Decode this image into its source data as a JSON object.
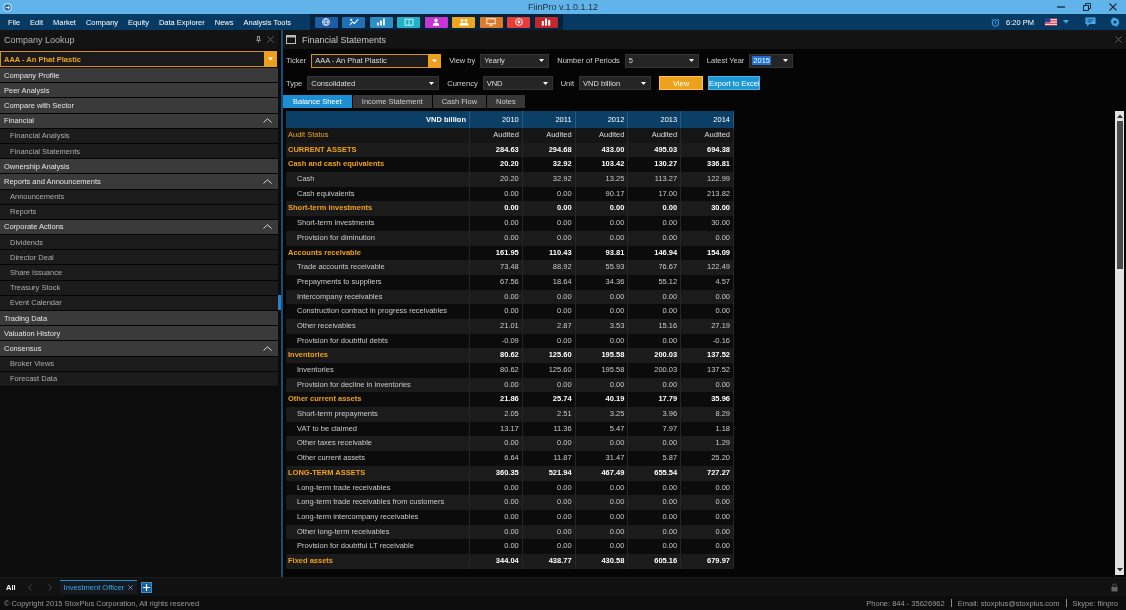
{
  "window": {
    "title": "FiinPro v.1.0.1.12"
  },
  "menu": [
    "File",
    "Edit",
    "Market",
    "Company",
    "Equity",
    "Data Explorer",
    "News",
    "Analysis Tools"
  ],
  "toolbar": [
    {
      "color": "#1f5ca6"
    },
    {
      "color": "#1f72b6"
    },
    {
      "color": "#2d8dc6"
    },
    {
      "color": "#20b2c8"
    },
    {
      "color": "#c634d4"
    },
    {
      "color": "#eea61f"
    },
    {
      "color": "#de7b2b"
    },
    {
      "color": "#e53c3c"
    },
    {
      "color": "#c1282d"
    }
  ],
  "clock": {
    "time": "6:20 PM"
  },
  "company_lookup": {
    "title": "Company Lookup",
    "ticker": "AAA - An Phat Plastic",
    "items": [
      {
        "label": "Company Profile"
      },
      {
        "label": "Peer Analysis"
      },
      {
        "label": "Compare with Sector"
      },
      {
        "label": "Financial",
        "expanded": true,
        "children": [
          {
            "label": "Financial Analysis"
          },
          {
            "label": "Financial Statements"
          }
        ]
      },
      {
        "label": "Ownership Analysis"
      },
      {
        "label": "Reports and Announcements",
        "expanded": true,
        "children": [
          {
            "label": "Announcements"
          },
          {
            "label": "Reports"
          }
        ]
      },
      {
        "label": "Corporate Actions",
        "expanded": true,
        "children": [
          {
            "label": "Dividends"
          },
          {
            "label": "Director Deal"
          },
          {
            "label": "Share Issuance"
          },
          {
            "label": "Treasury Stock"
          },
          {
            "label": "Event Calendar"
          }
        ]
      },
      {
        "label": "Trading Data"
      },
      {
        "label": "Valuation History"
      },
      {
        "label": "Consensus",
        "expanded": true,
        "children": [
          {
            "label": "Broker Views"
          },
          {
            "label": "Forecast Data"
          }
        ]
      }
    ]
  },
  "financial_statements": {
    "title": "Financial Statements",
    "filter_rows": [
      [
        {
          "label": "Ticker",
          "value": "AAA - An Phat Plastic",
          "focused": true,
          "text_selected": false
        },
        {
          "label": "View by",
          "value": "Yearly",
          "focused": false,
          "text_selected": false
        },
        {
          "label": "Number of Periods",
          "value": "5",
          "focused": false,
          "text_selected": false
        },
        {
          "label": "Latest Year",
          "value": "2015",
          "focused": false,
          "text_selected": true
        }
      ],
      [
        {
          "label": "Type",
          "value": "Consolidated",
          "focused": false,
          "text_selected": false
        },
        {
          "label": "Currency",
          "value": "VND",
          "focused": false,
          "text_selected": false
        },
        {
          "label": "Unit",
          "value": "VND billion",
          "focused": false,
          "text_selected": false
        }
      ]
    ],
    "buttons": [
      {
        "label": "View",
        "kind": "primary"
      },
      {
        "label": "Export to Excel",
        "kind": "export"
      }
    ],
    "tabs": [
      {
        "label": "Balance Sheet",
        "selected": true
      },
      {
        "label": "Income Statement",
        "selected": false
      },
      {
        "label": "Cash Flow",
        "selected": false
      },
      {
        "label": "Notes",
        "selected": false
      }
    ],
    "table": {
      "columns": [
        "VND billion",
        "2010",
        "2011",
        "2012",
        "2013",
        "2014"
      ],
      "rows": [
        {
          "kind": "audit",
          "label": "Audit Status",
          "values": [
            "Audited",
            "Audited",
            "Audited",
            "Audited",
            "Audited"
          ]
        },
        {
          "kind": "group",
          "label": "CURRENT ASSETS",
          "values": [
            "284.63",
            "294.68",
            "433.00",
            "495.03",
            "694.38"
          ]
        },
        {
          "kind": "group",
          "label": "Cash and cash equivalents",
          "values": [
            "20.20",
            "32.92",
            "103.42",
            "130.27",
            "336.81"
          ]
        },
        {
          "kind": "item",
          "label": "Cash",
          "values": [
            "20.20",
            "32.92",
            "13.25",
            "113.27",
            "122.99"
          ]
        },
        {
          "kind": "item",
          "label": "Cash equivalents",
          "values": [
            "0.00",
            "0.00",
            "90.17",
            "17.00",
            "213.82"
          ]
        },
        {
          "kind": "group",
          "label": "Short-term investments",
          "values": [
            "0.00",
            "0.00",
            "0.00",
            "0.00",
            "30.00"
          ]
        },
        {
          "kind": "item",
          "label": "Short-term investments",
          "values": [
            "0.00",
            "0.00",
            "0.00",
            "0.00",
            "30.00"
          ]
        },
        {
          "kind": "item",
          "label": "Provision for diminution",
          "values": [
            "0.00",
            "0.00",
            "0.00",
            "0.00",
            "0.00"
          ]
        },
        {
          "kind": "group",
          "label": "Accounts receivable",
          "values": [
            "161.95",
            "110.43",
            "93.81",
            "146.94",
            "154.09"
          ]
        },
        {
          "kind": "item",
          "label": "Trade accounts receivable",
          "values": [
            "73.48",
            "88.92",
            "55.93",
            "76.67",
            "122.49"
          ]
        },
        {
          "kind": "item",
          "label": "Prepayments to suppliers",
          "values": [
            "67.56",
            "18.64",
            "34.36",
            "55.12",
            "4.57"
          ]
        },
        {
          "kind": "item",
          "label": "Intercompany receivables",
          "values": [
            "0.00",
            "0.00",
            "0.00",
            "0.00",
            "0.00"
          ]
        },
        {
          "kind": "item",
          "label": "Construction contract in progress receivables",
          "values": [
            "0.00",
            "0.00",
            "0.00",
            "0.00",
            "0.00"
          ]
        },
        {
          "kind": "item",
          "label": "Other receivables",
          "values": [
            "21.01",
            "2.87",
            "3.53",
            "15.16",
            "27.19"
          ]
        },
        {
          "kind": "item",
          "label": "Provision for doubtful debts",
          "values": [
            "-0.09",
            "0.00",
            "0.00",
            "0.00",
            "-0.16"
          ]
        },
        {
          "kind": "group",
          "label": "Inventories",
          "values": [
            "80.62",
            "125.60",
            "195.58",
            "200.03",
            "137.52"
          ]
        },
        {
          "kind": "item",
          "label": "Inventories",
          "values": [
            "80.62",
            "125.60",
            "195.58",
            "200.03",
            "137.52"
          ]
        },
        {
          "kind": "item",
          "label": "Provision for decline in inventories",
          "values": [
            "0.00",
            "0.00",
            "0.00",
            "0.00",
            "0.00"
          ]
        },
        {
          "kind": "group",
          "label": "Other current assets",
          "values": [
            "21.86",
            "25.74",
            "40.19",
            "17.79",
            "35.96"
          ]
        },
        {
          "kind": "item",
          "label": "Short-term prepayments",
          "values": [
            "2.05",
            "2.51",
            "3.25",
            "3.96",
            "8.29"
          ]
        },
        {
          "kind": "item",
          "label": "VAT to be claimed",
          "values": [
            "13.17",
            "11.36",
            "5.47",
            "7.97",
            "1.18"
          ]
        },
        {
          "kind": "item",
          "label": "Other taxes receivable",
          "values": [
            "0.00",
            "0.00",
            "0.00",
            "0.00",
            "1.29"
          ]
        },
        {
          "kind": "item",
          "label": "Other current assets",
          "values": [
            "6.64",
            "11.87",
            "31.47",
            "5.87",
            "25.20"
          ]
        },
        {
          "kind": "group",
          "label": "LONG-TERM ASSETS",
          "values": [
            "360.35",
            "521.94",
            "467.49",
            "655.54",
            "727.27"
          ]
        },
        {
          "kind": "item",
          "label": "Long-term trade receivables",
          "values": [
            "0.00",
            "0.00",
            "0.00",
            "0.00",
            "0.00"
          ]
        },
        {
          "kind": "item",
          "label": "Long-term trade receivables from customers",
          "values": [
            "0.00",
            "0.00",
            "0.00",
            "0.00",
            "0.00"
          ]
        },
        {
          "kind": "item",
          "label": "Long-term intercompany receivables",
          "values": [
            "0.00",
            "0.00",
            "0.00",
            "0.00",
            "0.00"
          ]
        },
        {
          "kind": "item",
          "label": "Other long-term receivables",
          "values": [
            "0.00",
            "0.00",
            "0.00",
            "0.00",
            "0.00"
          ]
        },
        {
          "kind": "item",
          "label": "Provision for doubtful LT receivable",
          "values": [
            "0.00",
            "0.00",
            "0.00",
            "0.00",
            "0.00"
          ]
        },
        {
          "kind": "group",
          "label": "Fixed assets",
          "values": [
            "344.04",
            "438.77",
            "430.58",
            "605.16",
            "679.97"
          ]
        }
      ]
    }
  },
  "workspace_tabs": {
    "all_label": "All",
    "tabs": [
      {
        "label": "Investment Officer",
        "selected": true
      }
    ]
  },
  "status_bar": {
    "copyright": "© Copyright 2015 StoxPlus Corporation, All rights reserved",
    "contacts": [
      "Phone: 844 - 35626962",
      "Email: stoxplus@stoxplus.com",
      "Skype: fiinpro"
    ]
  }
}
